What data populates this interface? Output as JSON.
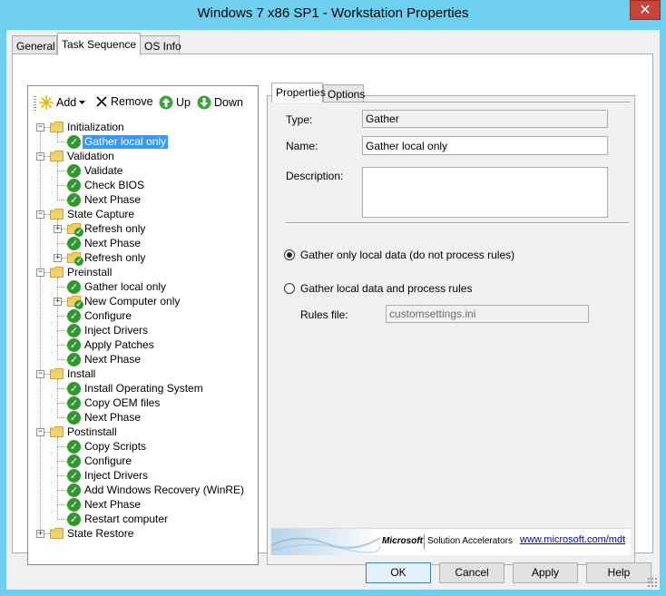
{
  "window": {
    "title": "Windows 7 x86 SP1 - Workstation Properties",
    "close_glyph": "✕"
  },
  "tabs": [
    {
      "label": "General"
    },
    {
      "label": "Task Sequence"
    },
    {
      "label": "OS Info"
    }
  ],
  "toolbar": {
    "add_label": "Add",
    "remove_label": "Remove",
    "up_label": "Up",
    "down_label": "Down"
  },
  "tree": [
    {
      "label": "Initialization",
      "type": "group",
      "level": 0
    },
    {
      "label": "Gather local only",
      "type": "step",
      "level": 1,
      "selected": true
    },
    {
      "label": "Validation",
      "type": "group",
      "level": 0
    },
    {
      "label": "Validate",
      "type": "step",
      "level": 1
    },
    {
      "label": "Check BIOS",
      "type": "step",
      "level": 1
    },
    {
      "label": "Next Phase",
      "type": "step",
      "level": 1
    },
    {
      "label": "State Capture",
      "type": "group",
      "level": 0
    },
    {
      "label": "Refresh only",
      "type": "subgroup",
      "level": 1
    },
    {
      "label": "Next Phase",
      "type": "step",
      "level": 1
    },
    {
      "label": "Refresh only",
      "type": "subgroup",
      "level": 1
    },
    {
      "label": "Preinstall",
      "type": "group",
      "level": 0
    },
    {
      "label": "Gather local only",
      "type": "step",
      "level": 1
    },
    {
      "label": "New Computer only",
      "type": "subgroup",
      "level": 1
    },
    {
      "label": "Configure",
      "type": "step",
      "level": 1
    },
    {
      "label": "Inject Drivers",
      "type": "step",
      "level": 1
    },
    {
      "label": "Apply Patches",
      "type": "step",
      "level": 1
    },
    {
      "label": "Next Phase",
      "type": "step",
      "level": 1
    },
    {
      "label": "Install",
      "type": "group",
      "level": 0
    },
    {
      "label": "Install Operating System",
      "type": "step",
      "level": 1
    },
    {
      "label": "Copy OEM files",
      "type": "step",
      "level": 1
    },
    {
      "label": "Next Phase",
      "type": "step",
      "level": 1
    },
    {
      "label": "Postinstall",
      "type": "group",
      "level": 0
    },
    {
      "label": "Copy Scripts",
      "type": "step",
      "level": 1
    },
    {
      "label": "Configure",
      "type": "step",
      "level": 1
    },
    {
      "label": "Inject Drivers",
      "type": "step",
      "level": 1
    },
    {
      "label": "Add Windows Recovery (WinRE)",
      "type": "step",
      "level": 1
    },
    {
      "label": "Next Phase",
      "type": "step",
      "level": 1
    },
    {
      "label": "Restart computer",
      "type": "step",
      "level": 1
    },
    {
      "label": "State Restore",
      "type": "group",
      "level": 0,
      "collapsed": true
    }
  ],
  "inner_tabs": [
    {
      "label": "Properties"
    },
    {
      "label": "Options"
    }
  ],
  "properties": {
    "type_label": "Type:",
    "type_value": "Gather",
    "name_label": "Name:",
    "name_value": "Gather local only",
    "description_label": "Description:",
    "description_value": "",
    "radio_local_label": "Gather only local data (do not process rules)",
    "radio_rules_label": "Gather local data and process rules",
    "rules_file_label": "Rules file:",
    "rules_file_value": "customsettings.ini"
  },
  "banner": {
    "brand": "Microsoft",
    "product": "Solution Accelerators",
    "link": "www.microsoft.com/mdt"
  },
  "buttons": {
    "ok": "OK",
    "cancel": "Cancel",
    "apply": "Apply",
    "help": "Help"
  },
  "colors": {
    "title_bar": "#6fcfee",
    "close": "#c7443b",
    "selection": "#3399ff",
    "check_green": "#2e9a2e",
    "folder_yellow": "#f3d26b"
  }
}
